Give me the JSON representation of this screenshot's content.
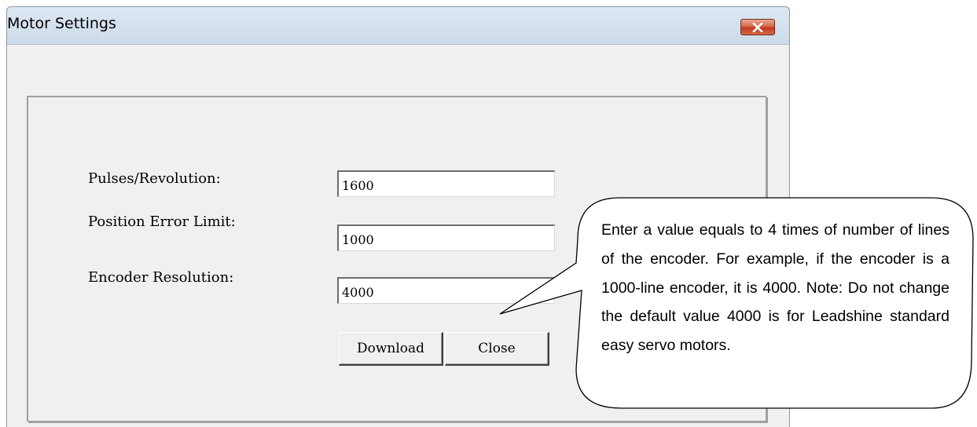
{
  "window": {
    "title": "Motor Settings",
    "close_icon": "close-x-icon"
  },
  "fields": [
    {
      "label": "Pulses/Revolution:",
      "value": "1600"
    },
    {
      "label": "Position Error Limit:",
      "value": "1000"
    },
    {
      "label": "Encoder Resolution:",
      "value": "4000"
    }
  ],
  "buttons": {
    "download_label": "Download",
    "close_label": "Close"
  },
  "callout": {
    "text": "Enter a value equals to 4 times of number of lines of the encoder. For example, if the encoder is a 1000-line encoder, it is 4000. Note: Do not change the default value 4000 is for Leadshine standard easy servo motors."
  },
  "colors": {
    "titlebar": "#cfdcea",
    "client_bg": "#f0f0f0",
    "close_button": "#c0391c"
  }
}
